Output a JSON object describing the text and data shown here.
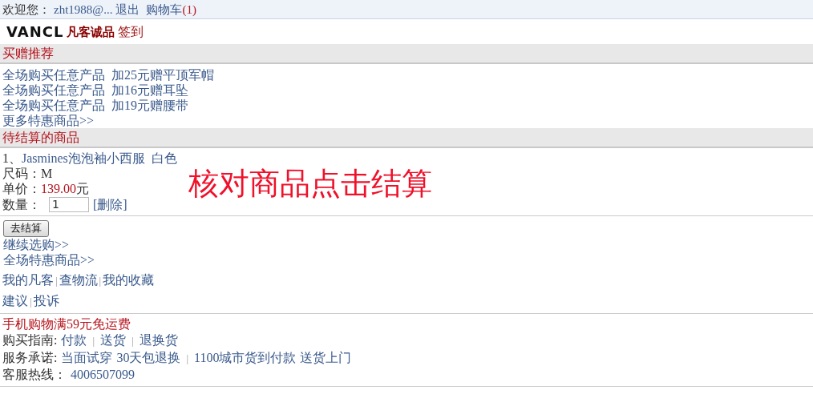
{
  "top_bar": {
    "welcome": "欢迎您：",
    "user": "zht1988@...",
    "logout": "退出",
    "cart": "购物车",
    "cart_count": "(1)"
  },
  "brand": {
    "logo": "VANCL",
    "tagline": "凡客诚品",
    "checkin": "签到"
  },
  "promo_section": {
    "title": "买赠推荐",
    "items": [
      "全场购买任意产品  加25元赠平顶军帽",
      "全场购买任意产品  加16元赠耳坠",
      "全场购买任意产品  加19元赠腰带"
    ],
    "more": "更多特惠商品>>"
  },
  "cart_section": {
    "title": "待结算的商品",
    "item": {
      "index": "1、",
      "name": "Jasmines泡泡袖小西服  白色",
      "size_label": "尺码：",
      "size": "M",
      "price_label": "单价：",
      "price": "139.00",
      "currency": "元",
      "qty_label": "数量：",
      "qty": "1",
      "delete": "[删除]"
    },
    "annotation": "核对商品点击结算"
  },
  "checkout_button": "去结算",
  "continue_links": [
    "继续选购>>",
    "全场特惠商品>>"
  ],
  "footer_lines": [
    [
      {
        "kind": "link",
        "text": "我的凡客"
      },
      {
        "kind": "sep",
        "text": "|"
      },
      {
        "kind": "link",
        "text": "查物流"
      },
      {
        "kind": "sep",
        "text": "|"
      },
      {
        "kind": "link",
        "text": "我的收藏"
      }
    ],
    [
      {
        "kind": "link",
        "text": "建议"
      },
      {
        "kind": "sep",
        "text": "|"
      },
      {
        "kind": "link",
        "text": "投诉"
      }
    ]
  ],
  "service": {
    "promo": "手机购物满59元免运费",
    "lines": [
      [
        {
          "kind": "label",
          "text": "购买指南:"
        },
        {
          "kind": "link",
          "text": "付款"
        },
        {
          "kind": "sep",
          "text": "|"
        },
        {
          "kind": "link",
          "text": "送货"
        },
        {
          "kind": "sep",
          "text": "|"
        },
        {
          "kind": "link",
          "text": "退换货"
        }
      ],
      [
        {
          "kind": "label",
          "text": "服务承诺:"
        },
        {
          "kind": "link",
          "text": "当面试穿"
        },
        {
          "kind": "link",
          "text": "30天包退换"
        },
        {
          "kind": "sep",
          "text": "|"
        },
        {
          "kind": "link",
          "text": "1100城市货到付款"
        },
        {
          "kind": "link",
          "text": "送货上门"
        }
      ],
      [
        {
          "kind": "label",
          "text": "客服热线："
        },
        {
          "kind": "link",
          "text": "4006507099"
        }
      ]
    ]
  }
}
